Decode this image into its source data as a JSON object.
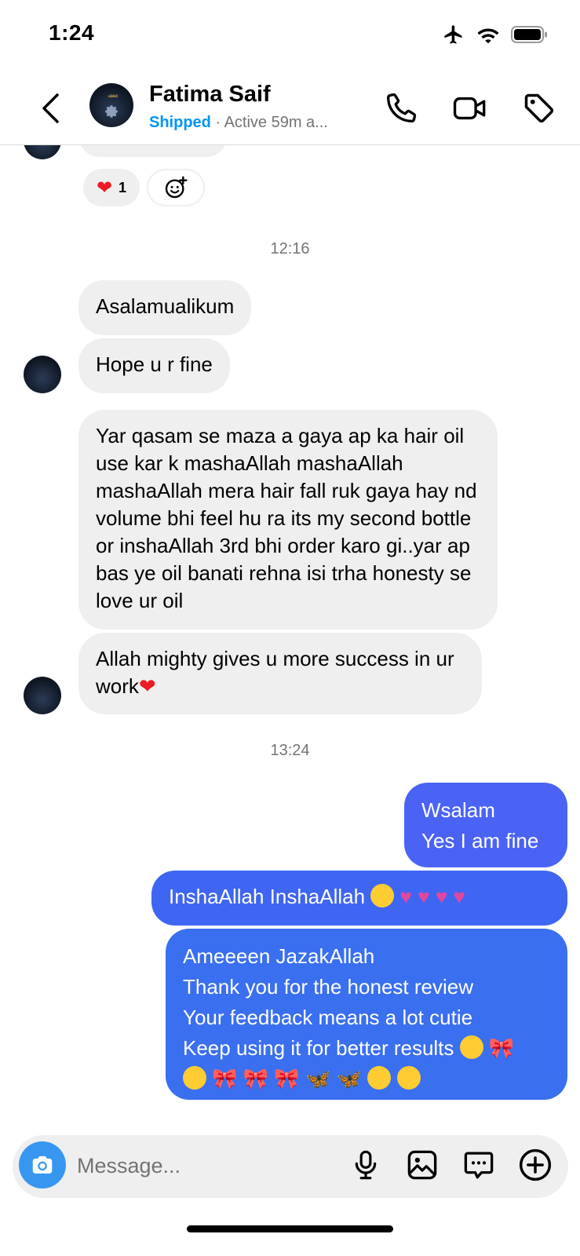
{
  "status_bar": {
    "time": "1:24"
  },
  "header": {
    "name": "Fatima Saif",
    "label": "Shipped",
    "separator": "·",
    "activity": "Active 59m a..."
  },
  "reactions": {
    "heart_count": "1"
  },
  "timestamps": [
    "12:16",
    "13:24"
  ],
  "incoming": [
    "Asalamualikum",
    "Hope u r fine",
    "Yar qasam se maza a gaya ap ka hair oil use kar k mashaAllah mashaAllah mashaAllah mera hair fall ruk gaya hay nd volume bhi feel hu ra its my second bottle or inshaAllah 3rd bhi order karo gi..yar ap bas ye oil banati rehna isi trha honesty se love ur oil",
    "Allah mighty gives u more success in ur work"
  ],
  "outgoing": {
    "msg1_line1": "Wsalam",
    "msg1_line2": "Yes I am fine",
    "msg2": "InshaAllah InshaAllah",
    "msg3_line1": "Ameeeen JazakAllah",
    "msg3_line2": "Thank you for the honest review",
    "msg3_line3": "Your feedback means a lot cutie",
    "msg3_line4": "Keep using it for better results"
  },
  "composer": {
    "placeholder": "Message..."
  },
  "colors": {
    "outgoing_top": "#4a63f5",
    "outgoing_mid": "#3f66f2",
    "outgoing_bottom": "#3a6ff0",
    "incoming": "#efefef",
    "accent": "#0095f6",
    "camera": "#3797f0"
  },
  "icons": [
    "back-icon",
    "phone-icon",
    "video-icon",
    "tag-icon",
    "camera-icon",
    "mic-icon",
    "gallery-icon",
    "sticker-icon",
    "plus-icon",
    "heart-emoji",
    "add-reaction-icon"
  ]
}
